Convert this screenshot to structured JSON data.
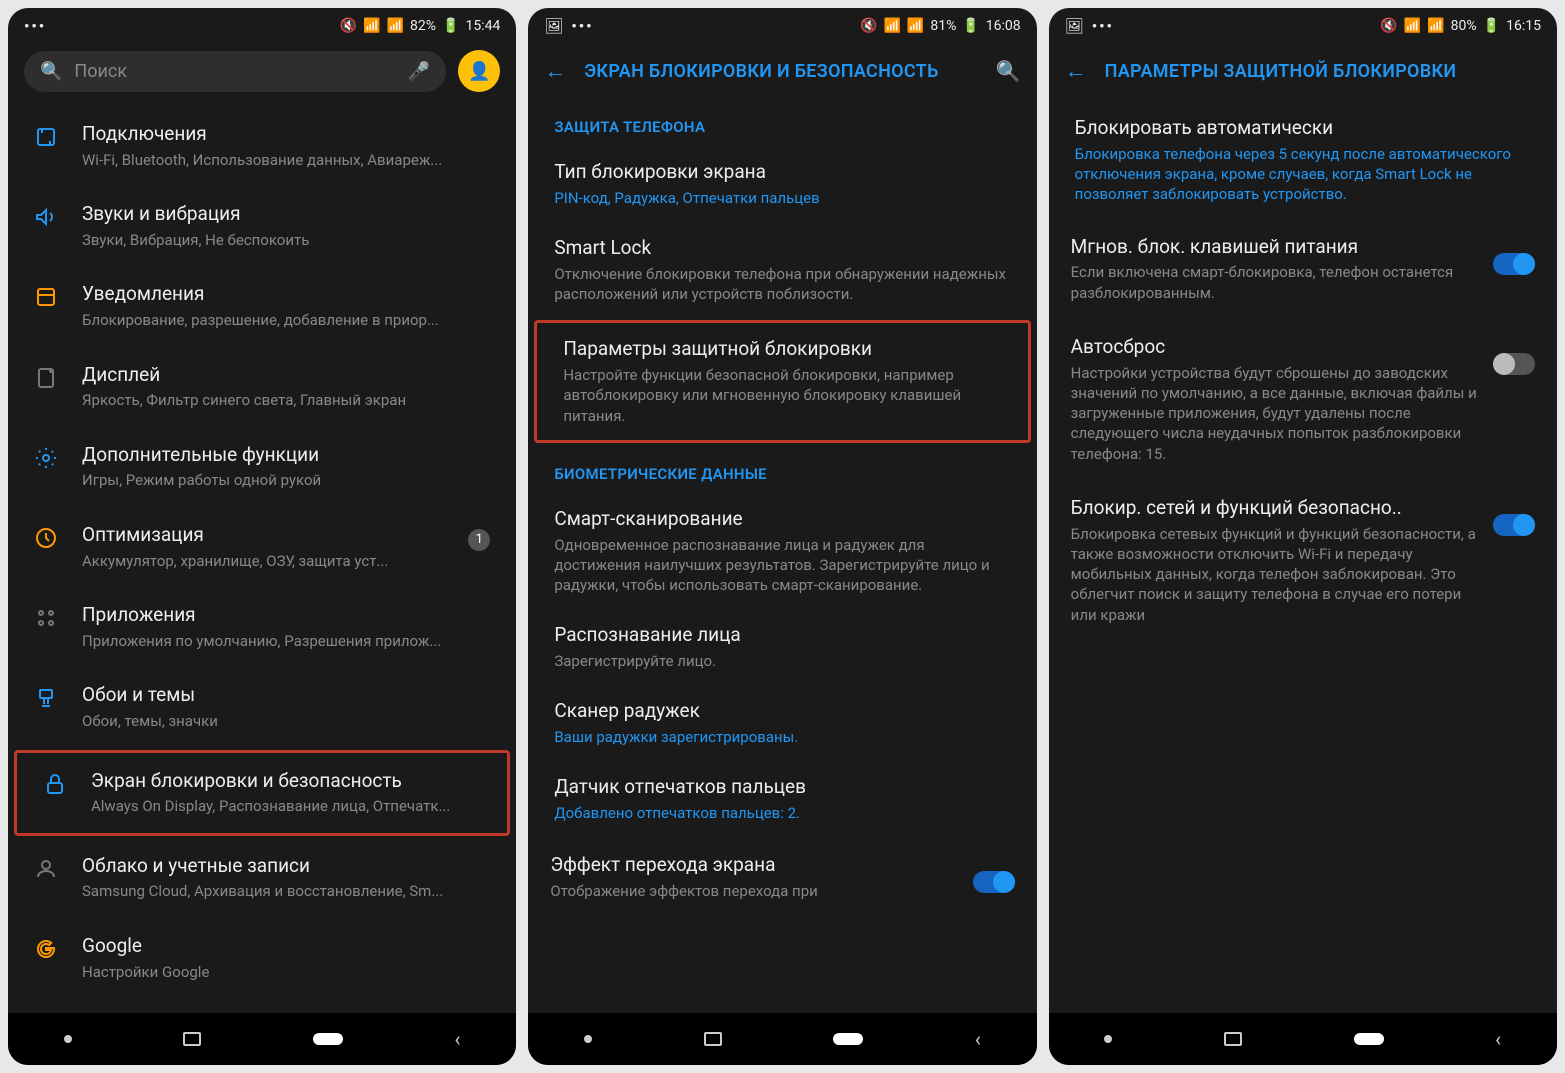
{
  "screen1": {
    "status": {
      "battery": "82%",
      "time": "15:44"
    },
    "search_placeholder": "Поиск",
    "items": [
      {
        "title": "Подключения",
        "sub": "Wi-Fi, Bluetooth, Использование данных, Авиареж..."
      },
      {
        "title": "Звуки и вибрация",
        "sub": "Звуки, Вибрация, Не беспокоить"
      },
      {
        "title": "Уведомления",
        "sub": "Блокирование, разрешение, добавление в приор..."
      },
      {
        "title": "Дисплей",
        "sub": "Яркость, Фильтр синего света, Главный экран"
      },
      {
        "title": "Дополнительные функции",
        "sub": "Игры, Режим работы одной рукой"
      },
      {
        "title": "Оптимизация",
        "sub": "Аккумулятор, хранилище, ОЗУ, защита уст...",
        "badge": "1"
      },
      {
        "title": "Приложения",
        "sub": "Приложения по умолчанию, Разрешения прилож..."
      },
      {
        "title": "Обои и темы",
        "sub": "Обои, темы, значки"
      },
      {
        "title": "Экран блокировки и безопасность",
        "sub": "Always On Display, Распознавание лица, Отпечатк..."
      },
      {
        "title": "Облако и учетные записи",
        "sub": "Samsung Cloud, Архивация и восстановление, Sm..."
      },
      {
        "title": "Google",
        "sub": "Настройки Google"
      }
    ]
  },
  "screen2": {
    "status": {
      "battery": "81%",
      "time": "16:08"
    },
    "title": "ЭКРАН БЛОКИРОВКИ И БЕЗОПАСНОСТЬ",
    "section1": "ЗАЩИТА ТЕЛЕФОНА",
    "items1": [
      {
        "title": "Тип блокировки экрана",
        "sub": "PIN-код, Радужка, Отпечатки пальцев",
        "blue": true
      },
      {
        "title": "Smart Lock",
        "sub": "Отключение блокировки телефона при обнаружении надежных расположений или устройств поблизости."
      },
      {
        "title": "Параметры защитной блокировки",
        "sub": "Настройте функции безопасной блокировки, например автоблокировку или мгновенную блокировку клавишей питания."
      }
    ],
    "section2": "БИОМЕТРИЧЕСКИЕ ДАННЫЕ",
    "items2": [
      {
        "title": "Смарт-сканирование",
        "sub": "Одновременное распознавание лица и радужек для достижения наилучших результатов. Зарегистрируйте лицо и радужки, чтобы использовать смарт-сканирование."
      },
      {
        "title": "Распознавание лица",
        "sub": "Зарегистрируйте лицо."
      },
      {
        "title": "Сканер радужек",
        "sub": "Ваши радужки зарегистрированы.",
        "blue": true
      },
      {
        "title": "Датчик отпечатков пальцев",
        "sub": "Добавлено отпечатков пальцев: 2.",
        "blue": true
      },
      {
        "title": "Эффект перехода экрана",
        "sub": "Отображение эффектов перехода при",
        "toggle": true
      }
    ]
  },
  "screen3": {
    "status": {
      "battery": "80%",
      "time": "16:15"
    },
    "title": "ПАРАМЕТРЫ ЗАЩИТНОЙ БЛОКИРОВКИ",
    "items": [
      {
        "title": "Блокировать автоматически",
        "sub": "Блокировка телефона через 5 секунд после автоматического отключения экрана, кроме случаев, когда Smart Lock не позволяет заблокировать устройство.",
        "blue": true
      },
      {
        "title": "Мгнов. блок. клавишей питания",
        "sub": "Если включена смарт-блокировка, телефон останется разблокированным.",
        "toggle": "on"
      },
      {
        "title": "Автосброс",
        "sub": "Настройки устройства будут сброшены до заводских значений по умолчанию, а все данные, включая файлы и загруженные приложения, будут удалены после следующего числа неудачных попыток разблокировки телефона: 15.",
        "toggle": "off"
      },
      {
        "title": "Блокир. сетей и функций безопасно..",
        "sub": "Блокировка сетевых функций и функций безопасности, а также возможности отключить Wi-Fi и передачу мобильных данных, когда телефон заблокирован. Это облегчит поиск и защиту телефона в случае его потери или кражи",
        "toggle": "on"
      }
    ]
  }
}
